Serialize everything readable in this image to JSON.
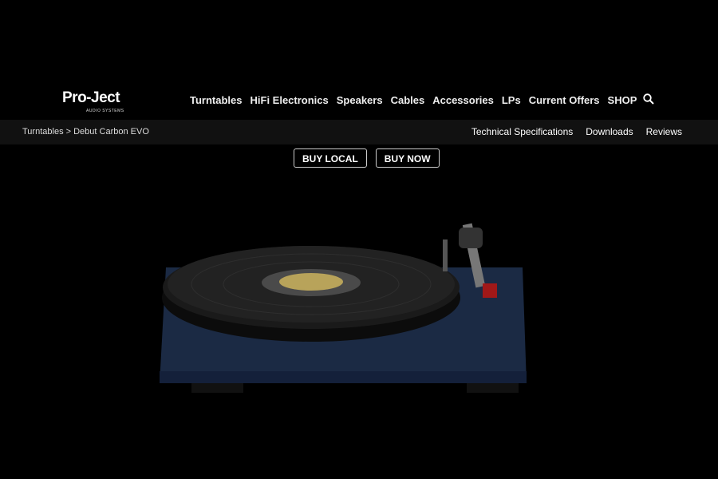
{
  "brand": {
    "name": "Pro-Ject",
    "tagline": "AUDIO SYSTEMS"
  },
  "nav": {
    "items": [
      "Turntables",
      "HiFi Electronics",
      "Speakers",
      "Cables",
      "Accessories",
      "LPs",
      "Current Offers",
      "SHOP"
    ],
    "search_icon": "search-icon"
  },
  "breadcrumb": "Turntables > Debut Carbon EVO",
  "subnav": [
    "Technical Specifications",
    "Downloads",
    "Reviews"
  ],
  "buttons": {
    "buy_local": "BUY LOCAL",
    "buy_now": "BUY NOW"
  },
  "colors": {
    "background": "#000000",
    "subbar": "#111111",
    "plinth": "#1b2a44"
  }
}
